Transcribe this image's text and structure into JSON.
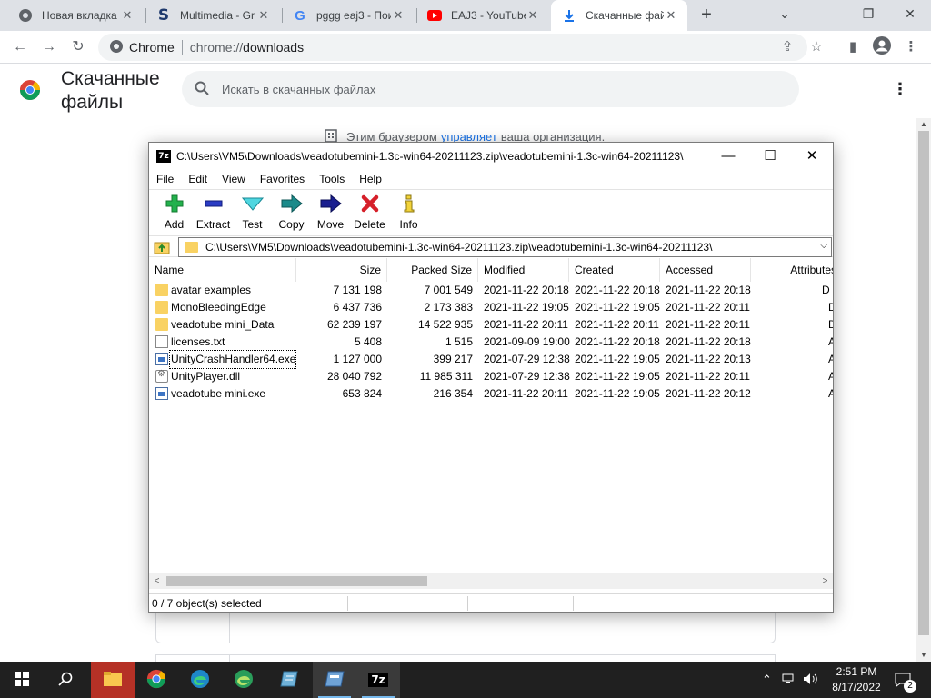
{
  "browser": {
    "tabs": [
      {
        "title": "Новая вкладка",
        "icon": "chrome-icon"
      },
      {
        "title": "Multimedia - Gr",
        "icon": "s-logo-icon"
      },
      {
        "title": "pggg eaj3 - Пои",
        "icon": "google-icon"
      },
      {
        "title": "EAJ3 - YouTube",
        "icon": "youtube-icon"
      },
      {
        "title": "Скачанные фай",
        "icon": "download-icon"
      }
    ],
    "active_tab": 4,
    "omnibox": {
      "site": "Chrome",
      "url_scheme": "chrome://",
      "url_host": "downloads"
    }
  },
  "downloads_page": {
    "title": "Скачанные файлы",
    "search_placeholder": "Искать в скачанных файлах",
    "managed_prefix": "Этим браузером",
    "managed_link": "управляет",
    "managed_suffix": "ваша организация."
  },
  "sevenzip": {
    "title": "C:\\Users\\VM5\\Downloads\\veadotubemini-1.3c-win64-20211123.zip\\veadotubemini-1.3c-win64-20211123\\",
    "menu": [
      "File",
      "Edit",
      "View",
      "Favorites",
      "Tools",
      "Help"
    ],
    "toolbar": [
      {
        "label": "Add",
        "icon": "add-icon"
      },
      {
        "label": "Extract",
        "icon": "extract-icon"
      },
      {
        "label": "Test",
        "icon": "test-icon"
      },
      {
        "label": "Copy",
        "icon": "copy-icon"
      },
      {
        "label": "Move",
        "icon": "move-icon"
      },
      {
        "label": "Delete",
        "icon": "delete-icon"
      },
      {
        "label": "Info",
        "icon": "info-icon"
      }
    ],
    "address": "C:\\Users\\VM5\\Downloads\\veadotubemini-1.3c-win64-20211123.zip\\veadotubemini-1.3c-win64-20211123\\",
    "columns": [
      "Name",
      "Size",
      "Packed Size",
      "Modified",
      "Created",
      "Accessed",
      "Attributes"
    ],
    "files": [
      {
        "name": "avatar examples",
        "type": "folder",
        "size": "7 131 198",
        "packed": "7 001 549",
        "modified": "2021-11-22 20:18",
        "created": "2021-11-22 20:18",
        "accessed": "2021-11-22 20:18",
        "attr": "D"
      },
      {
        "name": "MonoBleedingEdge",
        "type": "folder",
        "size": "6 437 736",
        "packed": "2 173 383",
        "modified": "2021-11-22 19:05",
        "created": "2021-11-22 19:05",
        "accessed": "2021-11-22 20:11",
        "attr": "D"
      },
      {
        "name": "veadotube mini_Data",
        "type": "folder",
        "size": "62 239 197",
        "packed": "14 522 935",
        "modified": "2021-11-22 20:11",
        "created": "2021-11-22 20:11",
        "accessed": "2021-11-22 20:11",
        "attr": "D"
      },
      {
        "name": "licenses.txt",
        "type": "txt",
        "size": "5 408",
        "packed": "1 515",
        "modified": "2021-09-09 19:00",
        "created": "2021-11-22 20:18",
        "accessed": "2021-11-22 20:18",
        "attr": "A"
      },
      {
        "name": "UnityCrashHandler64.exe",
        "type": "exe",
        "size": "1 127 000",
        "packed": "399 217",
        "modified": "2021-07-29 12:38",
        "created": "2021-11-22 19:05",
        "accessed": "2021-11-22 20:13",
        "attr": "A"
      },
      {
        "name": "UnityPlayer.dll",
        "type": "dll",
        "size": "28 040 792",
        "packed": "11 985 311",
        "modified": "2021-07-29 12:38",
        "created": "2021-11-22 19:05",
        "accessed": "2021-11-22 20:11",
        "attr": "A"
      },
      {
        "name": "veadotube mini.exe",
        "type": "exe",
        "size": "653 824",
        "packed": "216 354",
        "modified": "2021-11-22 20:11",
        "created": "2021-11-22 19:05",
        "accessed": "2021-11-22 20:12",
        "attr": "A"
      }
    ],
    "status": "0 / 7 object(s) selected"
  },
  "taskbar": {
    "time": "2:51 PM",
    "date": "8/17/2022",
    "notifications": "2"
  }
}
